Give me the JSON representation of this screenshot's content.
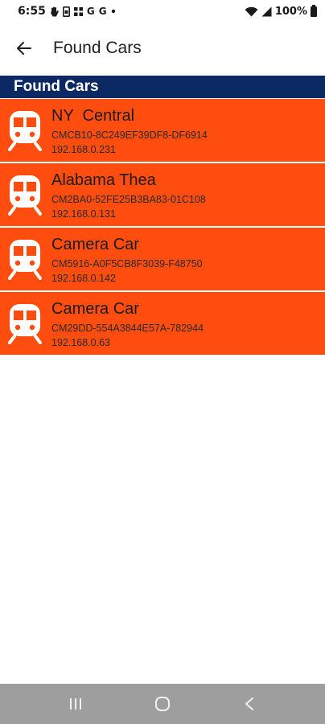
{
  "status_bar": {
    "time": "6:55",
    "notification_letters": [
      "G",
      "G"
    ],
    "battery": "100%"
  },
  "app_bar": {
    "title": "Found Cars"
  },
  "section": {
    "header": "Found Cars"
  },
  "cars": [
    {
      "name": "NY  Central",
      "id": "CMCB10-8C249EF39DF8-DF6914",
      "ip": "192.168.0.231"
    },
    {
      "name": "Alabama Thea",
      "id": "CM2BA0-52FE25B3BA83-01C108",
      "ip": "192.168.0.131"
    },
    {
      "name": "Camera Car",
      "id": "CM5916-A0F5CB8F3039-F48750",
      "ip": "192.168.0.142"
    },
    {
      "name": "Camera Car",
      "id": "CM29DD-554A3844E57A-782944",
      "ip": "192.168.0.63"
    }
  ],
  "colors": {
    "list_item_bg": "#ff4d0f",
    "section_header_bg": "#0b2a63",
    "nav_bar_bg": "#9e9e9e"
  },
  "icons": {
    "back": "arrow-left-icon",
    "car": "train-icon",
    "nav_recents": "recents-icon",
    "nav_home": "home-icon",
    "nav_back": "chevron-left-icon"
  }
}
